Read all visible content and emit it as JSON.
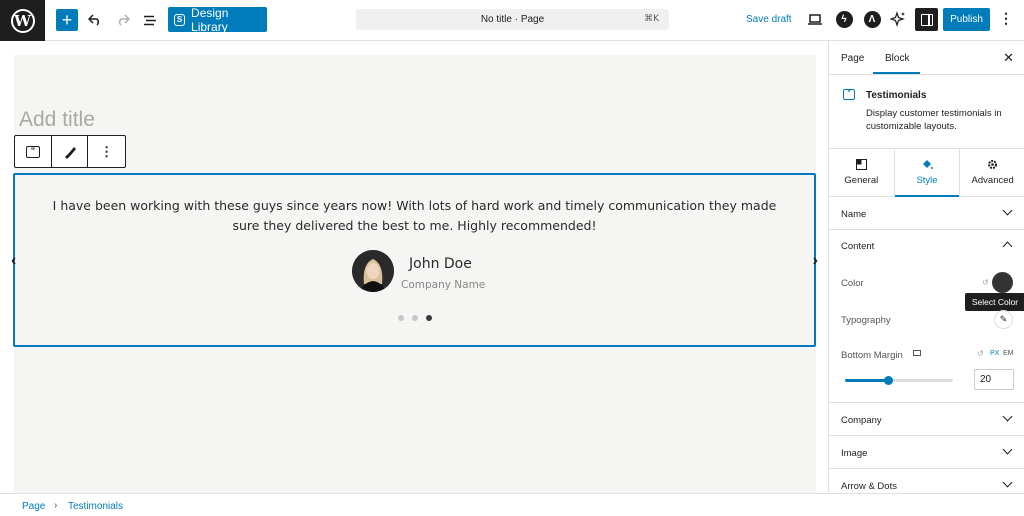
{
  "toolbar": {
    "wp_logo_letter": "W",
    "add_symbol": "+",
    "design_library_label": "Design Library",
    "doc_title": "No title · Page",
    "doc_shortcut": "⌘K",
    "save_draft_label": "Save draft",
    "publish_label": "Publish",
    "more_symbol": "⋮"
  },
  "editor": {
    "title_placeholder": "Add title",
    "testimonial": {
      "text": "I have been working with these guys since years now! With lots of hard work and timely communication they made sure they delivered the best to me. Highly recommended!",
      "name": "John Doe",
      "company": "Company Name",
      "dots_count": 3,
      "active_dot": 2
    }
  },
  "sidebar": {
    "tabs": {
      "page": "Page",
      "block": "Block"
    },
    "block_card": {
      "title": "Testimonials",
      "description": "Display customer testimonials in customizable layouts."
    },
    "style_tabs": {
      "general": "General",
      "style": "Style",
      "advanced": "Advanced"
    },
    "panels": {
      "name": "Name",
      "content": "Content",
      "company": "Company",
      "image": "Image",
      "arrow_dots": "Arrow & Dots"
    },
    "content_controls": {
      "color_label": "Color",
      "color_value": "#333333",
      "tooltip": "Select Color",
      "typography_label": "Typography",
      "bottom_margin_label": "Bottom Margin",
      "unit_px": "PX",
      "unit_em": "EM",
      "bottom_margin_value": "20",
      "slider_fraction": 0.4
    }
  },
  "breadcrumb": {
    "page": "Page",
    "current": "Testimonials"
  },
  "colors": {
    "accent": "#007cba",
    "dark": "#1e1e1e",
    "canvas": "#f5f5f3"
  }
}
